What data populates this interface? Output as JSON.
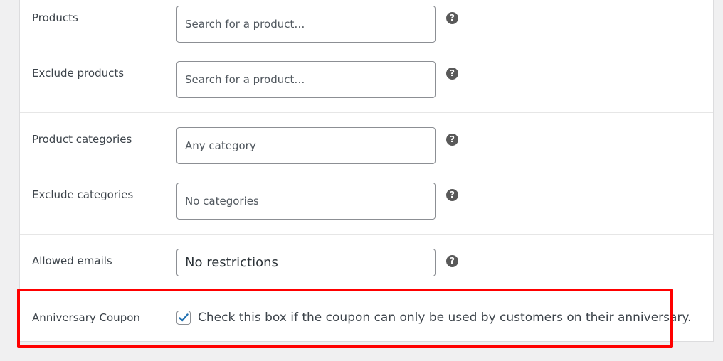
{
  "products": {
    "label": "Products",
    "placeholder": "Search for a product…",
    "help": "?"
  },
  "exclude_products": {
    "label": "Exclude products",
    "placeholder": "Search for a product…",
    "help": "?"
  },
  "product_categories": {
    "label": "Product categories",
    "placeholder": "Any category",
    "help": "?"
  },
  "exclude_categories": {
    "label": "Exclude categories",
    "placeholder": "No categories",
    "help": "?"
  },
  "allowed_emails": {
    "label": "Allowed emails",
    "placeholder": "No restrictions",
    "help": "?"
  },
  "anniversary_coupon": {
    "label": "Anniversary Coupon",
    "checked": true,
    "description": "Check this box if the coupon can only be used by customers on their anniversary."
  },
  "colors": {
    "highlight": "#ff0000",
    "checkmark": "#2271b1",
    "help_icon": "#595959"
  }
}
